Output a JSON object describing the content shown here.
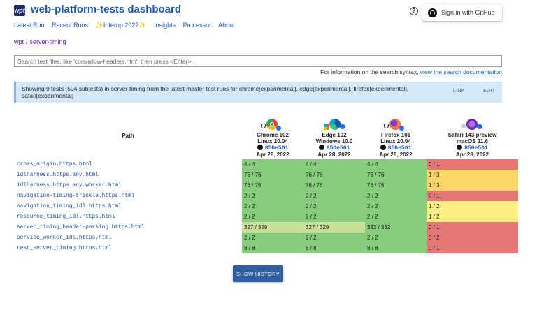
{
  "header": {
    "logo_text": "wpt",
    "title": "web-platform-tests dashboard",
    "help_symbol": "?",
    "signin_label": "Sign in with GitHub"
  },
  "nav": {
    "items": [
      "Latest Run",
      "Recent Runs",
      "Interop 2022",
      "Insights",
      "Processor",
      "About"
    ],
    "sparkle": "✨"
  },
  "breadcrumb": {
    "root": "wpt",
    "separator": "/",
    "current": "server-timing"
  },
  "search": {
    "placeholder": "Search test files, like 'cors/allow-headers.htm', then press <Enter>",
    "info_prefix": "For information on the search syntax, ",
    "info_link": "view the search documentation"
  },
  "banner": {
    "text": "Showing 9 tests (504 subtests) in server-timing from the latest master test runs for chrome[experimental], edge[experimental], firefox[experimental], safari[experimental]",
    "link_label": "LINK",
    "edit_label": "EDIT"
  },
  "table": {
    "path_header": "Path",
    "browsers": [
      {
        "name": "Chrome 102",
        "os": "Linux 20.04",
        "sha": "850e501",
        "date": "Apr 28, 2022"
      },
      {
        "name": "Edge 102",
        "os": "Windows 10.0",
        "sha": "850e501",
        "date": "Apr 28, 2022"
      },
      {
        "name": "Firefox 101",
        "os": "Linux 20.04",
        "sha": "850e501",
        "date": "Apr 28, 2022"
      },
      {
        "name": "Safari 143 preview",
        "os": "macOS 11.6",
        "sha": "850e501",
        "date": "Apr 28, 2022"
      }
    ],
    "rows": [
      {
        "path": "cross_origin.https.html",
        "results": [
          "4 / 4",
          "4 / 4",
          "4 / 4",
          "0 / 1"
        ]
      },
      {
        "path": "idlharness.https.any.html",
        "results": [
          "76 / 76",
          "76 / 76",
          "76 / 76",
          "1 / 3"
        ]
      },
      {
        "path": "idlharness.https.any.worker.html",
        "results": [
          "76 / 76",
          "76 / 76",
          "76 / 76",
          "1 / 3"
        ]
      },
      {
        "path": "navigation-timing-trickle.https.html",
        "results": [
          "2 / 2",
          "2 / 2",
          "2 / 2",
          "0 / 1"
        ]
      },
      {
        "path": "navigation_timing_idl.https.html",
        "results": [
          "2 / 2",
          "2 / 2",
          "2 / 2",
          "1 / 2"
        ]
      },
      {
        "path": "resource_timing_idl.https.html",
        "results": [
          "2 / 2",
          "2 / 2",
          "2 / 2",
          "1 / 2"
        ]
      },
      {
        "path": "server_timing_header-parsing.https.html",
        "results": [
          "327 / 329",
          "327 / 329",
          "332 / 332",
          "0 / 1"
        ]
      },
      {
        "path": "service_worker_idl.https.html",
        "results": [
          "2 / 2",
          "2 / 2",
          "2 / 2",
          "0 / 2"
        ]
      },
      {
        "path": "test_server_timing.https.html",
        "results": [
          "8 / 8",
          "8 / 8",
          "8 / 8",
          "0 / 1"
        ]
      }
    ]
  },
  "history_label": "SHOW HISTORY",
  "colors": {
    "pass": "#88cc7e",
    "partial_pass": "#c7e09a",
    "fail": "#e77777",
    "low": "#fbd76a",
    "mid": "#fbef85",
    "link": "#1a55b5",
    "banner": "#d6e9fb"
  }
}
